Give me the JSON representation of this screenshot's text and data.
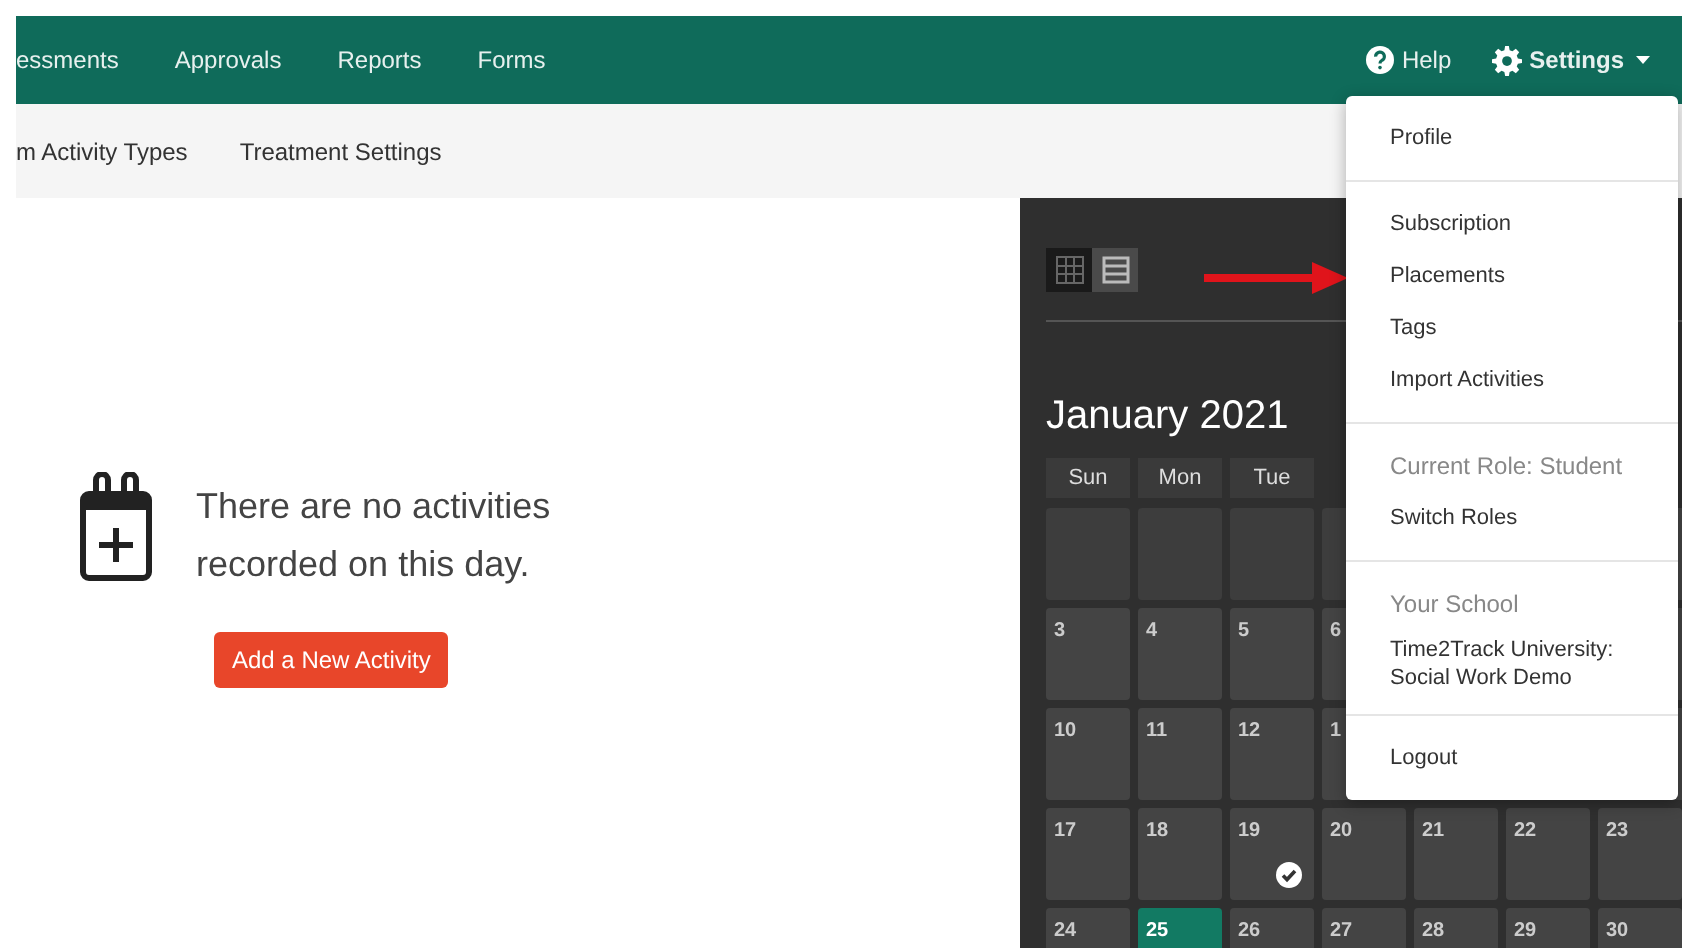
{
  "top_nav": {
    "items": [
      "essments",
      "Approvals",
      "Reports",
      "Forms"
    ],
    "help": "Help",
    "settings": "Settings"
  },
  "sub_nav": {
    "items": [
      "m Activity Types",
      "Treatment Settings"
    ]
  },
  "empty_state": {
    "message": "There are no activities recorded on this day.",
    "button": "Add a New Activity"
  },
  "calendar": {
    "view_toggle": [
      {
        "kind": "grid",
        "selected": true
      },
      {
        "kind": "list",
        "selected": false
      }
    ],
    "title": "January 2021",
    "weekdays": [
      "Sun",
      "Mon",
      "Tue"
    ],
    "weeks": [
      [
        {
          "kind": "blank"
        },
        {
          "kind": "blank"
        },
        {
          "kind": "blank"
        },
        {
          "kind": "blank"
        }
      ],
      [
        {
          "kind": "day",
          "day": "3",
          "checked": false,
          "selected": false
        },
        {
          "kind": "day",
          "day": "4",
          "checked": false,
          "selected": false
        },
        {
          "kind": "day",
          "day": "5",
          "checked": false,
          "selected": false
        },
        {
          "kind": "day",
          "day": "6",
          "selected": false
        }
      ],
      [
        {
          "kind": "day",
          "day": "10",
          "checked": false,
          "selected": false
        },
        {
          "kind": "day",
          "day": "11",
          "checked": false,
          "selected": false
        },
        {
          "kind": "day",
          "day": "12",
          "checked": false,
          "selected": false
        },
        {
          "kind": "day",
          "day": "1",
          "selected": false
        }
      ],
      [
        {
          "kind": "day",
          "day": "17",
          "checked": false,
          "selected": false
        },
        {
          "kind": "day",
          "day": "18",
          "checked": false,
          "selected": false
        },
        {
          "kind": "day",
          "day": "19",
          "checked": true,
          "selected": false
        },
        {
          "kind": "day",
          "day": "20",
          "checked": false,
          "selected": false
        },
        {
          "kind": "day",
          "day": "21",
          "checked": false,
          "selected": false
        },
        {
          "kind": "day",
          "day": "22",
          "checked": false,
          "selected": false
        },
        {
          "kind": "day",
          "day": "23",
          "checked": false,
          "selected": false
        }
      ],
      [
        {
          "kind": "day",
          "day": "24",
          "selected": false
        },
        {
          "kind": "day",
          "day": "25",
          "selected": true
        },
        {
          "kind": "day",
          "day": "26",
          "selected": false
        },
        {
          "kind": "day",
          "day": "27",
          "selected": false
        },
        {
          "kind": "day",
          "day": "28",
          "selected": false
        },
        {
          "kind": "day",
          "day": "29",
          "selected": false
        },
        {
          "kind": "day",
          "day": "30",
          "selected": false
        }
      ]
    ]
  },
  "settings_menu": [
    {
      "kind": "item",
      "label": "Profile"
    },
    {
      "kind": "divider"
    },
    {
      "kind": "item",
      "label": "Subscription"
    },
    {
      "kind": "item",
      "label": "Placements"
    },
    {
      "kind": "item",
      "label": "Tags"
    },
    {
      "kind": "item",
      "label": "Import Activities"
    },
    {
      "kind": "divider"
    },
    {
      "kind": "header",
      "label": "Current Role: Student"
    },
    {
      "kind": "item",
      "label": "Switch Roles"
    },
    {
      "kind": "divider"
    },
    {
      "kind": "header",
      "label": "Your School"
    },
    {
      "kind": "text",
      "label": "Time2Track University: Social Work Demo"
    },
    {
      "kind": "divider"
    },
    {
      "kind": "item",
      "label": "Logout"
    }
  ]
}
